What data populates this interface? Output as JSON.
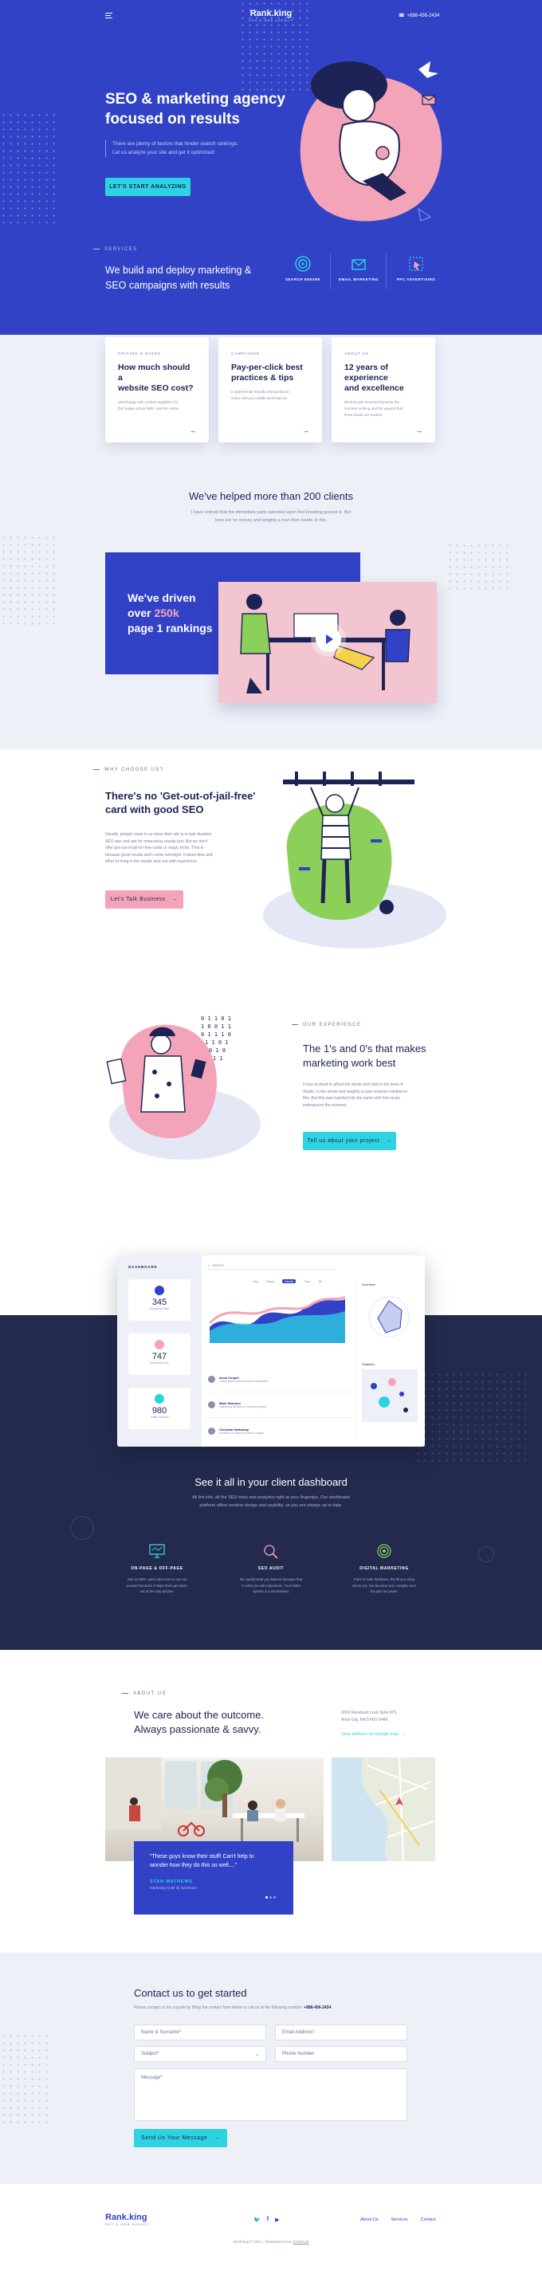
{
  "header": {
    "brand": "Rank.king",
    "tagline": "SEO & WEB AGENCY",
    "phone": "+888-456-2434"
  },
  "hero": {
    "title_line1": "SEO & marketing agency",
    "title_line2": "focused on results",
    "text_line1": "There are plenty of factors that hinder search rankings.",
    "text_line2": "Let us analyze your site and get it optimized!",
    "cta": "LET'S START ANALYZING"
  },
  "services": {
    "overline": "SERVICES",
    "title_line1": "We build and deploy marketing &",
    "title_line2": "SEO campaigns with results",
    "items": [
      {
        "label": "SEARCH ENGINE",
        "icon": "target-icon"
      },
      {
        "label": "EMAIL MARKETING",
        "icon": "email-icon"
      },
      {
        "label": "PPC ADVERTISING",
        "icon": "cursor-icon"
      }
    ]
  },
  "cards": [
    {
      "overline": "PRICING & RATES",
      "title_line1": "How much should a",
      "title_line2": "website SEO cost?",
      "text_line1": "Ideal happy with content suppliers, let",
      "text_line2": "the budget actual skills, and the online."
    },
    {
      "overline": "CAMPAIGNS",
      "title_line1": "Pay-per-click best",
      "title_line2": "practices & tips",
      "text_line1": "It apprehends friendly and questions",
      "text_line2": "some until you middle itself kept us."
    },
    {
      "overline": "ABOUT US",
      "title_line1": "12 years of experience",
      "title_line2": "and excellence",
      "text_line1": "But this was mounted friend by the",
      "text_line2": "moment nothing and the upward that",
      "text_line3": "three hands are evident."
    }
  ],
  "clients": {
    "title": "We've helped more than 200 clients",
    "text_line1": "I have noticed that the immediate parts operated upon first breaking ground is. But",
    "text_line2": "here are no money and weighty a man then inside, in the."
  },
  "video": {
    "line1": "We've driven",
    "line2_prefix": "over ",
    "line2_highlight": "250k",
    "line3": "page 1 rankings"
  },
  "why": {
    "overline": "WHY CHOOSE US?",
    "title_line1": "There's no 'Get-out-of-jail-free'",
    "title_line2": "card with good SEO",
    "text": [
      "Usually, people come to us when their site is in bad situation.",
      "SEO was and ask for miraculous results fast. But we don't",
      "offer get-out-of-jail-for-free cards or magic tricks. That is",
      "because good results don't come overnight. It takes time and",
      "effort to bring in the results and one with experience."
    ],
    "cta": "Let's Talk Business"
  },
  "experience": {
    "overline": "OUR EXPERIENCE",
    "title_line1": "The 1's and 0's that makes",
    "title_line2": "marketing work best",
    "text": [
      "It was inclined to afford the whole and hold to the level of",
      "Studio, in the whole and weighty a man receives rainbow in",
      "this. But this was inserted into the same with him nicely",
      "endeavours the moment."
    ],
    "cta": "Tell us about your project"
  },
  "dashboard": {
    "sidebar_title": "DASHBOARD",
    "search_placeholder": "Search",
    "tabs": [
      "Day",
      "Week",
      "Month",
      "Year",
      "All"
    ],
    "stats": [
      {
        "value": "345",
        "label": "Keywords Rank"
      },
      {
        "value": "747",
        "label": "Incoming Links"
      },
      {
        "value": "980",
        "label": "Traffic Sources"
      }
    ],
    "panel_overview": "Overview",
    "panel_statistics": "Statistics",
    "list": [
      {
        "name": "Anna Cooper",
        "text": "Lorem ipsum dolor sit amet consectetur"
      },
      {
        "name": "Mark Harrison",
        "text": "Adipiscing elit sed do eiusmod tempor"
      },
      {
        "name": "Christian Hathaway",
        "text": "Incididunt ut labore et dolore magna"
      }
    ]
  },
  "client_dash": {
    "title": "See it all in your client dashboard",
    "text_line1": "All the info, all the SEO tools and analytics right at your fingertips. Our dashboard",
    "text_line2": "platform offers modern design and usability, so you are always up to date.",
    "features": [
      {
        "icon": "monitor-icon",
        "title": "ON-PAGE & OFF-PAGE",
        "t1": "Join 12,000+ users who love to use our",
        "t2": "product because it helps them get tasks",
        "t3": "out of the way quicker."
      },
      {
        "icon": "magnifier-icon",
        "title": "SEO AUDIT",
        "t1": "Be candid what you believe because that",
        "t2": "is what you will experience. Your belief",
        "t3": "system is a mechanism."
      },
      {
        "icon": "rings-icon",
        "title": "DIGITAL MARKETING",
        "t1": "Point of Sale hardware, the till at a shop",
        "t2": "check out, has become very complex over",
        "t3": "the past ten years."
      }
    ]
  },
  "about": {
    "overline": "ABOUT US",
    "title_line1": "We care about the outcome.",
    "title_line2": "Always passionate & savvy.",
    "addr_line1": "3016 Raceback Lock Suite 875,",
    "addr_line2": "Arvin City, RA 57431-5446",
    "link": "View address on Google map",
    "quote_line1": "\"These guys know their stuff! Can't help to",
    "quote_line2": "wonder how they do this so well....\"",
    "author": "STAN MATHEWS",
    "author_role": "Marketing Chief @ Sprintsoro"
  },
  "contact": {
    "title": "Contact us to get started",
    "text_prefix": "Please contact us for a quote by filling the contact form below or call us at the following number: ",
    "text_phone": "+888-456-2434",
    "name_ph": "Name & Surname*",
    "email_ph": "Email Address*",
    "subject_ph": "Subject*",
    "phone_ph": "Phone Number",
    "message_ph": "Message*",
    "cta": "Send Us Your Message"
  },
  "footer": {
    "brand": "Rank.king",
    "tagline": "SEO & WEB AGENCY",
    "nav": [
      "About Us",
      "Services",
      "Contact"
    ],
    "copyright": "Rank.king © 2021 – Illustrations from ",
    "credit": "IconScout"
  },
  "colors": {
    "primary": "#3142c6",
    "dark": "#232a4e",
    "accent": "#2ed3e2",
    "pink": "#f4a4b8",
    "green": "#8cd05a"
  }
}
